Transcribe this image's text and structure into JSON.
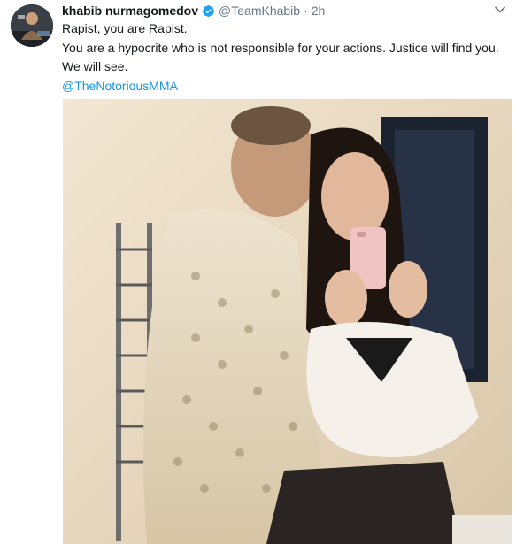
{
  "tweet": {
    "display_name": "khabib nurmagomedov",
    "handle": "@TeamKhabib",
    "separator": "·",
    "timestamp": "2h",
    "lines": [
      "Rapist, you are Rapist.",
      "You are a hypocrite who is not responsible for your actions. Justice will find you.",
      "We will see."
    ],
    "mention": "@TheNotoriousMMA"
  },
  "icons": {
    "verified": "verified-badge-icon",
    "more": "chevron-down-icon"
  },
  "colors": {
    "text": "#14171a",
    "secondary": "#657786",
    "link": "#1b95e0",
    "verified": "#1da1f2"
  }
}
